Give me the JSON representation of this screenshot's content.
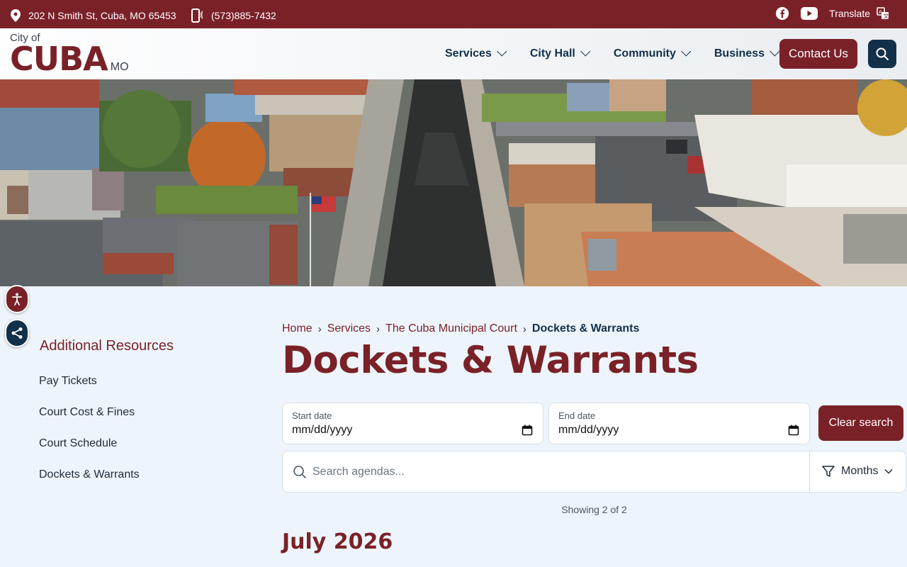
{
  "topbar": {
    "address": "202 N Smith St, Cuba, MO 65453",
    "phone": "(573)885-7432",
    "translate": "Translate"
  },
  "header": {
    "logo_small": "City of",
    "logo_big": "CUBA",
    "logo_state": "MO",
    "nav": [
      "Services",
      "City Hall",
      "Community",
      "Business"
    ],
    "contact": "Contact Us"
  },
  "sidebar": {
    "title": "Additional Resources",
    "links": [
      "Pay Tickets",
      "Court Cost & Fines",
      "Court Schedule",
      "Dockets & Warrants"
    ]
  },
  "breadcrumb": [
    "Home",
    "Services",
    "The Cuba Municipal Court",
    "Dockets & Warrants"
  ],
  "page_title": "Dockets & Warrants",
  "filters": {
    "start_label": "Start date",
    "start_value": "mm/dd/yyyy",
    "end_label": "End date",
    "end_value": "mm/dd/yyyy",
    "clear": "Clear search",
    "search_placeholder": "Search agendas...",
    "months": "Months"
  },
  "showing": "Showing 2 of 2",
  "month_heading": "July 2026",
  "colors": {
    "brand": "#7a2128",
    "navy": "#12304a",
    "background": "#eef4fb"
  }
}
